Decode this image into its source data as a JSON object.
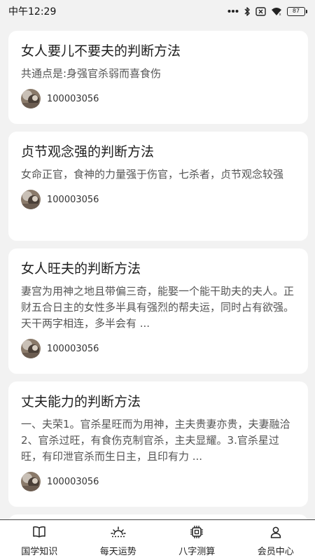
{
  "status_bar": {
    "time": "中午12:29",
    "battery": "87"
  },
  "articles": [
    {
      "title": "女人要儿不要夫的判断方法",
      "summary": "共通点是:身强官杀弱而喜食伤",
      "author": "100003056"
    },
    {
      "title": "贞节观念强的判断方法",
      "summary": "女命正官，食神的力量强于伤官，七杀者，贞节观念较强",
      "author": "100003056"
    },
    {
      "title": "女人旺夫的判断方法",
      "summary": "妻宫为用神之地且带偏三奇，能娶一个能干助夫的夫人。正财五合日主的女性多半具有强烈的帮夫运，同时占有欲强。天干两字相连，多半会有 ...",
      "author": "100003056"
    },
    {
      "title": "丈夫能力的判断方法",
      "summary": "一、夫荣1。官杀星旺而为用神，主夫贵妻亦贵，夫妻融洽2、官杀过旺，有食伤克制官杀，主夫显耀。3.官杀星过旺，有印泄官杀而生日主，且印有力 ...",
      "author": "100003056"
    }
  ],
  "tabbar": {
    "tabs": [
      {
        "label": "国学知识",
        "icon": "book-icon"
      },
      {
        "label": "每天运势",
        "icon": "sunrise-icon"
      },
      {
        "label": "八字测算",
        "icon": "chip-icon"
      },
      {
        "label": "会员中心",
        "icon": "user-icon"
      }
    ]
  }
}
